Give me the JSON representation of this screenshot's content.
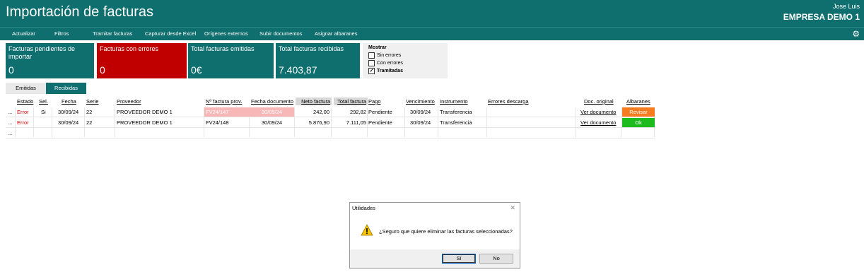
{
  "header": {
    "title": "Importación de facturas",
    "user": "Jose Luis",
    "company": "EMPRESA DEMO 1"
  },
  "menu": [
    "Actualizar",
    "Filtros",
    "Tramitar facturas",
    "Capturar desde Excel",
    "Orígenes externos",
    "Subir documentos",
    "Asignar albaranes"
  ],
  "cards": [
    {
      "label": "Facturas pendientes de importar",
      "value": "0"
    },
    {
      "label": "Facturas con errores",
      "value": "0"
    },
    {
      "label": "Total facturas emitidas",
      "value": "0€"
    },
    {
      "label": "Total facturas recibidas",
      "value": "7.403,87"
    }
  ],
  "mostrar": {
    "title": "Mostrar",
    "options": [
      {
        "label": "Sin errores",
        "checked": false
      },
      {
        "label": "Con errores",
        "checked": false
      },
      {
        "label": "Tramitadas",
        "checked": true
      }
    ]
  },
  "tabs": {
    "emitidas": "Emitidas",
    "recibidas": "Recibidas"
  },
  "columns": {
    "estado": "Estado",
    "sel": "Sel.",
    "fecha": "Fecha",
    "serie": "Serie",
    "proveedor": "Proveedor",
    "nfactura": "Nº factura prov.",
    "fechadoc": "Fecha documento",
    "neto": "Neto factura",
    "total": "Total factura",
    "pago": "Pago",
    "vencimiento": "Vencimiento",
    "instrumento": "Instrumento",
    "errores": "Errores descarga",
    "doc": "Doc. original",
    "albaranes": "Albaranes"
  },
  "rows": [
    {
      "dots": "...",
      "estado": "Error",
      "sel": "Si",
      "fecha": "30/09/24",
      "serie": "22",
      "proveedor": "PROVEEDOR DEMO 1",
      "nfactura": "FV24/147",
      "fechadoc": "30/09/24",
      "neto": "242,00",
      "total": "292,82",
      "pago": "Pendiente",
      "vencimiento": "30/09/24",
      "instrumento": "Transferencia",
      "doc": "Ver documento",
      "albaranes": "Revisar"
    },
    {
      "dots": "...",
      "estado": "Error",
      "sel": "",
      "fecha": "30/09/24",
      "serie": "22",
      "proveedor": "PROVEEDOR DEMO 1",
      "nfactura": "FV24/148",
      "fechadoc": "30/09/24",
      "neto": "5.876,90",
      "total": "7.111,05",
      "pago": "Pendiente",
      "vencimiento": "30/09/24",
      "instrumento": "Transferencia",
      "doc": "Ver documento",
      "albaranes": "Ok"
    },
    {
      "dots": "..."
    }
  ],
  "dialog": {
    "title": "Utilidades",
    "message": "¿Seguro que quiere eliminar las facturas seleccionadas?",
    "yes": "Sí",
    "no": "No",
    "icon": "warning-icon"
  },
  "colors": {
    "teal": "#0f6e6e",
    "error_red": "#c00000",
    "revisar": "#f57c1f",
    "ok": "#1dbb1d"
  }
}
